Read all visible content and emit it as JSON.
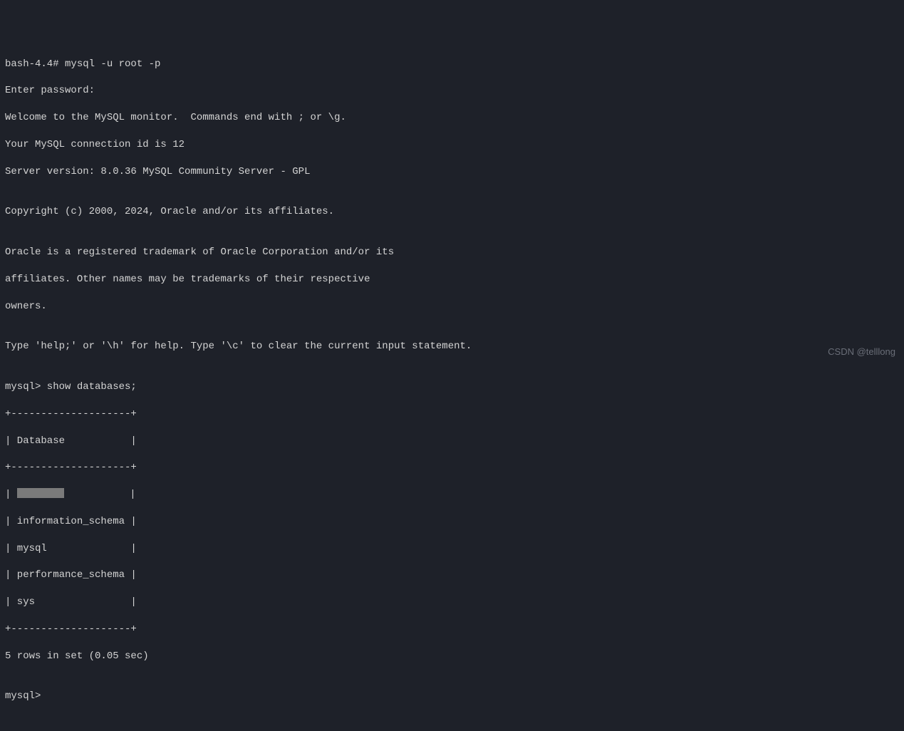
{
  "terminal": {
    "line1": "bash-4.4# mysql -u root -p",
    "line2": "Enter password: ",
    "line3": "Welcome to the MySQL monitor.  Commands end with ; or \\g.",
    "line4": "Your MySQL connection id is 12",
    "line5": "Server version: 8.0.36 MySQL Community Server - GPL",
    "blank1": "",
    "line6": "Copyright (c) 2000, 2024, Oracle and/or its affiliates.",
    "blank2": "",
    "line7": "Oracle is a registered trademark of Oracle Corporation and/or its",
    "line8": "affiliates. Other names may be trademarks of their respective",
    "line9": "owners.",
    "blank3": "",
    "line10": "Type 'help;' or '\\h' for help. Type '\\c' to clear the current input statement.",
    "blank4": "",
    "line11": "mysql> show databases;",
    "border": "+--------------------+",
    "header": "| Database           |",
    "row1_pre": "| ",
    "row1_post": "           |",
    "row2": "| information_schema |",
    "row3": "| mysql              |",
    "row4": "| performance_schema |",
    "row5": "| sys                |",
    "result": "5 rows in set (0.05 sec)",
    "blank5": "",
    "prompt": "mysql> "
  },
  "watermark": "CSDN @telllong"
}
